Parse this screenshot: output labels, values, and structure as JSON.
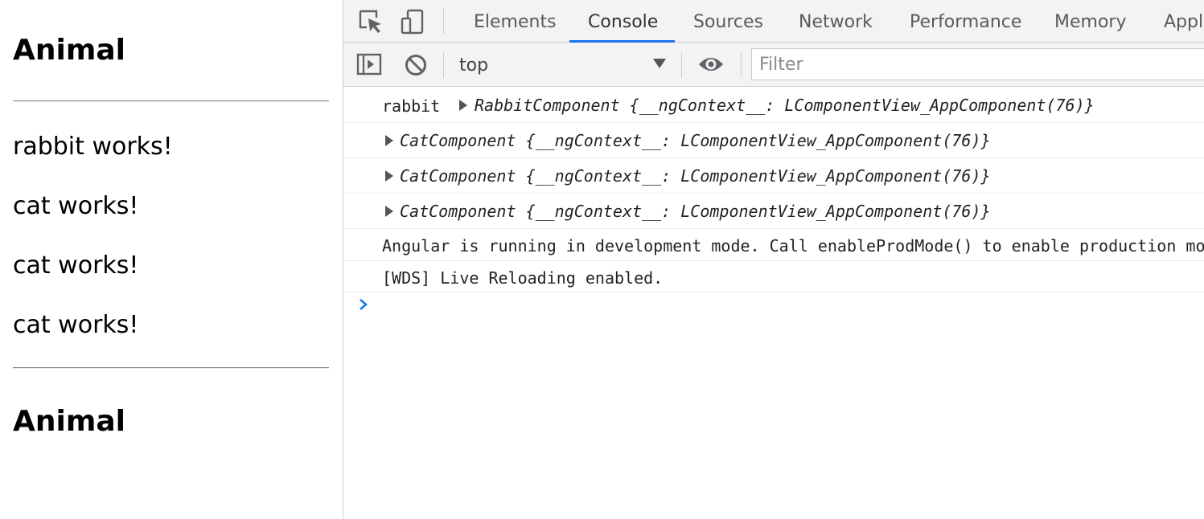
{
  "page": {
    "heading_top": "Animal",
    "items": [
      "rabbit works!",
      "cat works!",
      "cat works!",
      "cat works!"
    ],
    "heading_bottom": "Animal"
  },
  "devtools": {
    "tabs": [
      {
        "label": "Elements",
        "active": false
      },
      {
        "label": "Console",
        "active": true
      },
      {
        "label": "Sources",
        "active": false
      },
      {
        "label": "Network",
        "active": false
      },
      {
        "label": "Performance",
        "active": false
      },
      {
        "label": "Memory",
        "active": false
      },
      {
        "label": "Appl",
        "active": false
      }
    ],
    "icons": {
      "inspect": "inspect-element-icon",
      "device": "device-toolbar-icon",
      "sidebar": "console-sidebar-icon",
      "clear": "clear-console-icon",
      "eye": "live-expression-icon",
      "prompt": "console-prompt-icon"
    },
    "context": "top",
    "filter_placeholder": "Filter",
    "accent": "#1a73e8",
    "messages": [
      {
        "prefix": "rabbit",
        "class_name": "RabbitComponent",
        "key": "__ngContext__",
        "value": "LComponentView_AppComponent(76)"
      },
      {
        "class_name": "CatComponent",
        "key": "__ngContext__",
        "value": "LComponentView_AppComponent(76)"
      },
      {
        "class_name": "CatComponent",
        "key": "__ngContext__",
        "value": "LComponentView_AppComponent(76)"
      },
      {
        "class_name": "CatComponent",
        "key": "__ngContext__",
        "value": "LComponentView_AppComponent(76)"
      },
      {
        "text": "Angular is running in development mode. Call enableProdMode() to enable production mode."
      },
      {
        "text": "[WDS] Live Reloading enabled."
      }
    ]
  }
}
